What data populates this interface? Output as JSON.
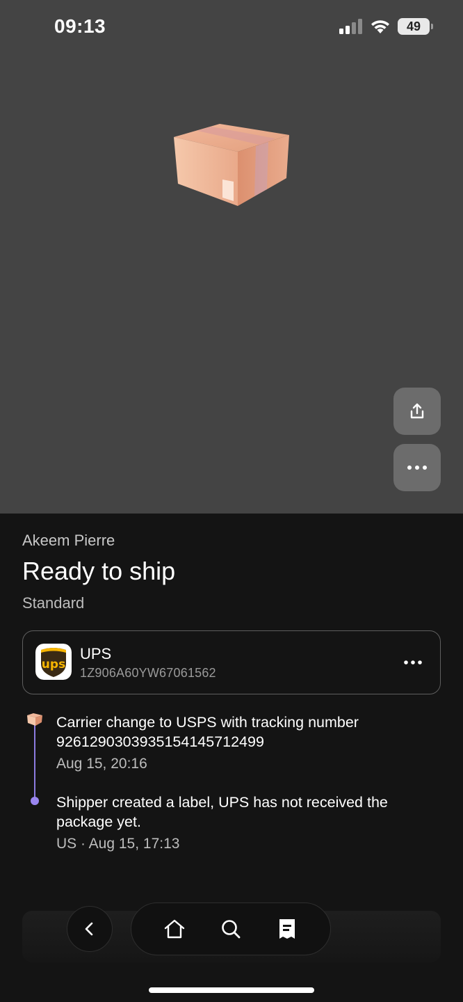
{
  "status_bar": {
    "time": "09:13",
    "battery": "49",
    "icons": [
      "cellular-signal-icon",
      "wifi-icon",
      "battery-icon"
    ]
  },
  "hero": {
    "illustration": "package-box-icon",
    "actions": [
      {
        "name": "share",
        "icon": "share-icon"
      },
      {
        "name": "more",
        "icon": "more-horizontal-icon"
      }
    ]
  },
  "shipment": {
    "recipient": "Akeem Pierre",
    "status": "Ready to ship",
    "service": "Standard"
  },
  "carrier": {
    "name": "UPS",
    "logo_text": "ups",
    "tracking_number": "1Z906A60YW67061562",
    "menu_icon": "more-horizontal-icon"
  },
  "timeline": [
    {
      "text": "Carrier change to USPS with tracking number 9261290303935154145712499",
      "meta": "Aug 15, 20:16",
      "marker": "package-box-icon"
    },
    {
      "text": "Shipper created a label, UPS has not received the package yet.",
      "meta": "US · Aug 15, 17:13",
      "marker": "dot"
    }
  ],
  "bottom_nav": {
    "back_icon": "chevron-left-icon",
    "items": [
      {
        "name": "home",
        "icon": "home-icon"
      },
      {
        "name": "search",
        "icon": "search-icon"
      },
      {
        "name": "receipt",
        "icon": "receipt-icon"
      }
    ]
  },
  "colors": {
    "hero_bg": "#444444",
    "page_bg": "#141414",
    "timeline_accent": "#9a86f0",
    "ups_brown": "#3a2a14",
    "ups_gold": "#f7b500"
  }
}
